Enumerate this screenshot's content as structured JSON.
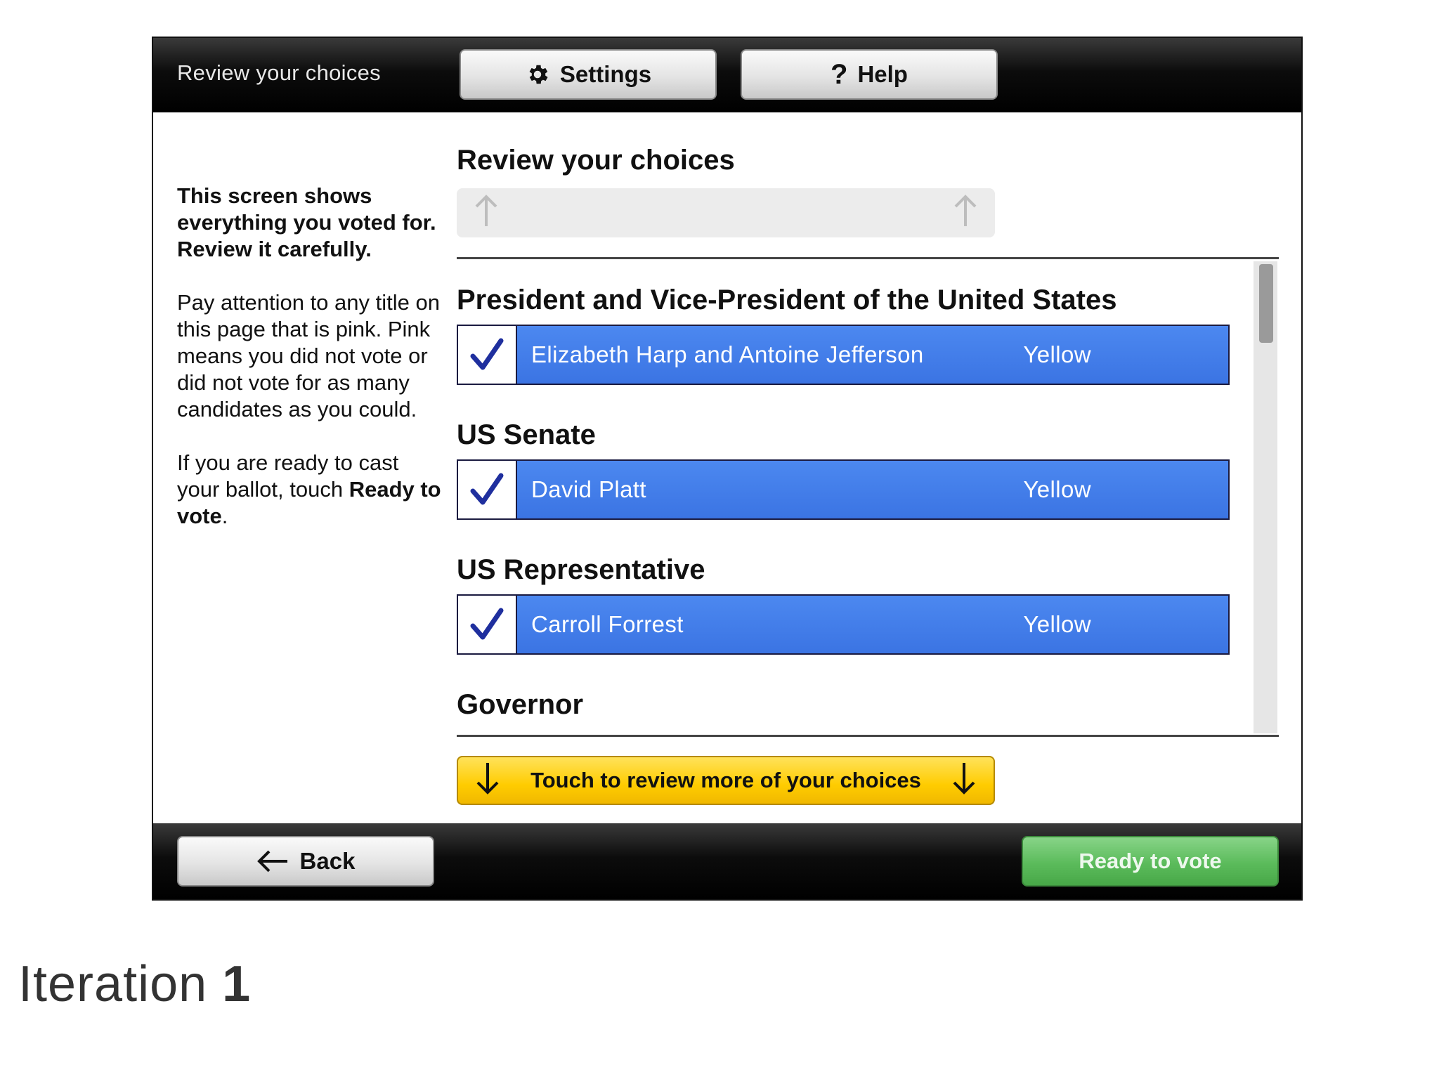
{
  "header": {
    "screen_title": "Review your choices",
    "settings_label": "Settings",
    "help_label": "Help"
  },
  "instructions": {
    "lead": "This screen shows everything you voted for. Review it carefully.",
    "paragraph1": "Pay attention to any title on this page that is pink. Pink means you did not vote or did not vote for as many candidates as you could.",
    "paragraph2_prefix": "If you are ready to cast your ballot, touch ",
    "paragraph2_bold": "Ready to vote",
    "paragraph2_suffix": "."
  },
  "main": {
    "title": "Review your choices",
    "more_label": "Touch to review more of your choices"
  },
  "contests": [
    {
      "title": "President and Vice-President of the United States",
      "choice": "Elizabeth Harp and Antoine Jefferson",
      "party": "Yellow"
    },
    {
      "title": "US Senate",
      "choice": "David Platt",
      "party": "Yellow"
    },
    {
      "title": "US Representative",
      "choice": "Carroll Forrest",
      "party": "Yellow"
    },
    {
      "title": "Governor"
    }
  ],
  "footer": {
    "back_label": "Back",
    "ready_label": "Ready to vote"
  },
  "caption": {
    "word": "Iteration",
    "number": "1"
  },
  "colors": {
    "choice_blue": "#3d79e8",
    "more_yellow": "#ffcc00",
    "ready_green": "#5bbb5b"
  }
}
